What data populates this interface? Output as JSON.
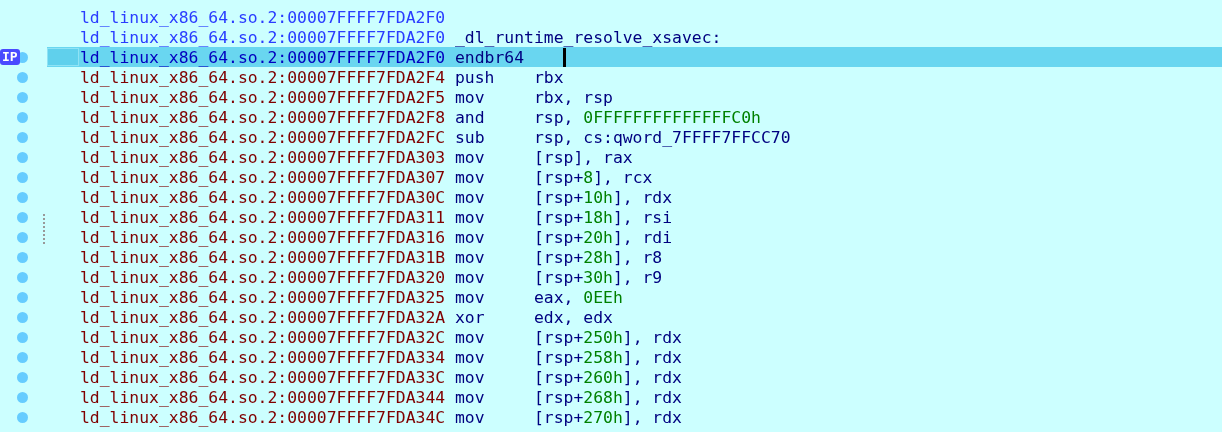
{
  "listing": {
    "rows": [
      {
        "address": "ld_linux_x86_64.so.2:00007FFFF7FDA2F0",
        "head": true,
        "kind": "blank",
        "selected": false,
        "ip": false,
        "dot": false
      },
      {
        "address": "ld_linux_x86_64.so.2:00007FFFF7FDA2F0",
        "head": true,
        "kind": "label",
        "text": "_dl_runtime_resolve_xsavec:",
        "selected": false,
        "ip": false,
        "dot": false
      },
      {
        "address": "ld_linux_x86_64.so.2:00007FFFF7FDA2F0",
        "head": true,
        "kind": "instruction",
        "mnemonic": "endbr64",
        "operands": [],
        "selected": true,
        "ip": true,
        "dot": true,
        "cursor": true
      },
      {
        "address": "ld_linux_x86_64.so.2:00007FFFF7FDA2F4",
        "head": false,
        "kind": "instruction",
        "mnemonic": "push",
        "operands": [
          {
            "text": "rbx"
          }
        ],
        "selected": false,
        "ip": false,
        "dot": true
      },
      {
        "address": "ld_linux_x86_64.so.2:00007FFFF7FDA2F5",
        "head": false,
        "kind": "instruction",
        "mnemonic": "mov",
        "operands": [
          {
            "text": "rbx, rsp"
          }
        ],
        "selected": false,
        "ip": false,
        "dot": true
      },
      {
        "address": "ld_linux_x86_64.so.2:00007FFFF7FDA2F8",
        "head": false,
        "kind": "instruction",
        "mnemonic": "and",
        "operands": [
          {
            "text": "rsp, "
          },
          {
            "text": "0FFFFFFFFFFFFFFC0h",
            "kind": "number"
          }
        ],
        "selected": false,
        "ip": false,
        "dot": true
      },
      {
        "address": "ld_linux_x86_64.so.2:00007FFFF7FDA2FC",
        "head": false,
        "kind": "instruction",
        "mnemonic": "sub",
        "operands": [
          {
            "text": "rsp, cs:qword_7FFFF7FFCC70"
          }
        ],
        "selected": false,
        "ip": false,
        "dot": true
      },
      {
        "address": "ld_linux_x86_64.so.2:00007FFFF7FDA303",
        "head": false,
        "kind": "instruction",
        "mnemonic": "mov",
        "operands": [
          {
            "text": "[rsp], rax"
          }
        ],
        "selected": false,
        "ip": false,
        "dot": true
      },
      {
        "address": "ld_linux_x86_64.so.2:00007FFFF7FDA307",
        "head": false,
        "kind": "instruction",
        "mnemonic": "mov",
        "operands": [
          {
            "text": "[rsp+"
          },
          {
            "text": "8",
            "kind": "number"
          },
          {
            "text": "], rcx"
          }
        ],
        "selected": false,
        "ip": false,
        "dot": true
      },
      {
        "address": "ld_linux_x86_64.so.2:00007FFFF7FDA30C",
        "head": false,
        "kind": "instruction",
        "mnemonic": "mov",
        "operands": [
          {
            "text": "[rsp+"
          },
          {
            "text": "10h",
            "kind": "number"
          },
          {
            "text": "], rdx"
          }
        ],
        "selected": false,
        "ip": false,
        "dot": true
      },
      {
        "address": "ld_linux_x86_64.so.2:00007FFFF7FDA311",
        "head": false,
        "kind": "instruction",
        "mnemonic": "mov",
        "operands": [
          {
            "text": "[rsp+"
          },
          {
            "text": "18h",
            "kind": "number"
          },
          {
            "text": "], rsi"
          }
        ],
        "selected": false,
        "ip": false,
        "dot": true
      },
      {
        "address": "ld_linux_x86_64.so.2:00007FFFF7FDA316",
        "head": false,
        "kind": "instruction",
        "mnemonic": "mov",
        "operands": [
          {
            "text": "[rsp+"
          },
          {
            "text": "20h",
            "kind": "number"
          },
          {
            "text": "], rdi"
          }
        ],
        "selected": false,
        "ip": false,
        "dot": true
      },
      {
        "address": "ld_linux_x86_64.so.2:00007FFFF7FDA31B",
        "head": false,
        "kind": "instruction",
        "mnemonic": "mov",
        "operands": [
          {
            "text": "[rsp+"
          },
          {
            "text": "28h",
            "kind": "number"
          },
          {
            "text": "], r8"
          }
        ],
        "selected": false,
        "ip": false,
        "dot": true
      },
      {
        "address": "ld_linux_x86_64.so.2:00007FFFF7FDA320",
        "head": false,
        "kind": "instruction",
        "mnemonic": "mov",
        "operands": [
          {
            "text": "[rsp+"
          },
          {
            "text": "30h",
            "kind": "number"
          },
          {
            "text": "], r9"
          }
        ],
        "selected": false,
        "ip": false,
        "dot": true
      },
      {
        "address": "ld_linux_x86_64.so.2:00007FFFF7FDA325",
        "head": false,
        "kind": "instruction",
        "mnemonic": "mov",
        "operands": [
          {
            "text": "eax, "
          },
          {
            "text": "0EEh",
            "kind": "number"
          }
        ],
        "selected": false,
        "ip": false,
        "dot": true
      },
      {
        "address": "ld_linux_x86_64.so.2:00007FFFF7FDA32A",
        "head": false,
        "kind": "instruction",
        "mnemonic": "xor",
        "operands": [
          {
            "text": "edx, edx"
          }
        ],
        "selected": false,
        "ip": false,
        "dot": true
      },
      {
        "address": "ld_linux_x86_64.so.2:00007FFFF7FDA32C",
        "head": false,
        "kind": "instruction",
        "mnemonic": "mov",
        "operands": [
          {
            "text": "[rsp+"
          },
          {
            "text": "250h",
            "kind": "number"
          },
          {
            "text": "], rdx"
          }
        ],
        "selected": false,
        "ip": false,
        "dot": true
      },
      {
        "address": "ld_linux_x86_64.so.2:00007FFFF7FDA334",
        "head": false,
        "kind": "instruction",
        "mnemonic": "mov",
        "operands": [
          {
            "text": "[rsp+"
          },
          {
            "text": "258h",
            "kind": "number"
          },
          {
            "text": "], rdx"
          }
        ],
        "selected": false,
        "ip": false,
        "dot": true
      },
      {
        "address": "ld_linux_x86_64.so.2:00007FFFF7FDA33C",
        "head": false,
        "kind": "instruction",
        "mnemonic": "mov",
        "operands": [
          {
            "text": "[rsp+"
          },
          {
            "text": "260h",
            "kind": "number"
          },
          {
            "text": "], rdx"
          }
        ],
        "selected": false,
        "ip": false,
        "dot": true
      },
      {
        "address": "ld_linux_x86_64.so.2:00007FFFF7FDA344",
        "head": false,
        "kind": "instruction",
        "mnemonic": "mov",
        "operands": [
          {
            "text": "[rsp+"
          },
          {
            "text": "268h",
            "kind": "number"
          },
          {
            "text": "], rdx"
          }
        ],
        "selected": false,
        "ip": false,
        "dot": true
      },
      {
        "address": "ld_linux_x86_64.so.2:00007FFFF7FDA34C",
        "head": false,
        "kind": "instruction",
        "mnemonic": "mov",
        "operands": [
          {
            "text": "[rsp+"
          },
          {
            "text": "270h",
            "kind": "number"
          },
          {
            "text": "], rdx"
          }
        ],
        "selected": false,
        "ip": false,
        "dot": true
      }
    ],
    "ip_label": "IP"
  }
}
